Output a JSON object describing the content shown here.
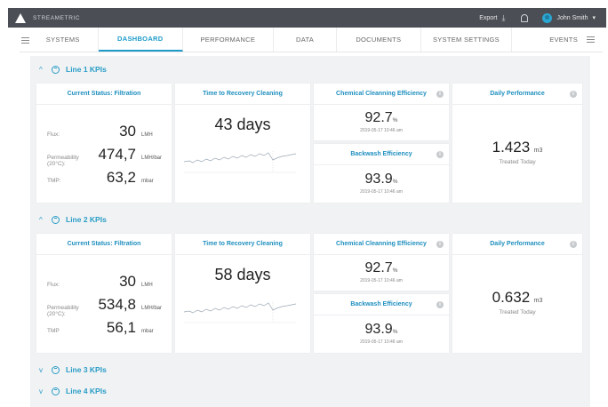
{
  "topbar": {
    "brand": "STREAMETRIC",
    "export_label": "Export",
    "user_name": "John Smith",
    "caret": "▾"
  },
  "nav": {
    "items": [
      {
        "label": "SYSTEMS"
      },
      {
        "label": "DASHBOARD"
      },
      {
        "label": "PERFORMANCE"
      },
      {
        "label": "DATA"
      },
      {
        "label": "DOCUMENTS"
      },
      {
        "label": "SYSTEM SETTINGS"
      },
      {
        "label": "EVENTS"
      }
    ],
    "active_index": 1
  },
  "lines": [
    {
      "title": "Line 1 KPIs",
      "expanded": true,
      "status_title": "Current Status: Filtration",
      "flux_label": "Flux:",
      "flux_value": "30",
      "flux_unit": "LMH",
      "perm_label": "Permeability (20°C):",
      "perm_value": "474,7",
      "perm_unit": "LMH/bar",
      "tmp_label": "TMP:",
      "tmp_value": "63,2",
      "tmp_unit": "mbar",
      "recovery_title": "Time to Recovery Cleaning",
      "recovery_value": "43 days",
      "chem_title": "Chemical Cleanning Efficiency",
      "chem_value": "92.7",
      "chem_unit": "%",
      "chem_ts": "2019-05-17 10:46 am",
      "back_title": "Backwash Efficiency",
      "back_value": "93.9",
      "back_unit": "%",
      "back_ts": "2019-05-17 10:46 am",
      "daily_title": "Daily Performance",
      "daily_value": "1.423",
      "daily_unit": "m3",
      "daily_sub": "Treated Today"
    },
    {
      "title": "Line 2 KPIs",
      "expanded": true,
      "status_title": "Current Status: Filtration",
      "flux_label": "Flux:",
      "flux_value": "30",
      "flux_unit": "LMH",
      "perm_label": "Permeability (20°C):",
      "perm_value": "534,8",
      "perm_unit": "LMH/bar",
      "tmp_label": "TMP",
      "tmp_value": "56,1",
      "tmp_unit": "mbar",
      "recovery_title": "Time to Recovery Cleaning",
      "recovery_value": "58 days",
      "chem_title": "Chemical Cleanning Efficiency",
      "chem_value": "92.7",
      "chem_unit": "%",
      "chem_ts": "2019-05-17 10:46 am",
      "back_title": "Backwash Efficiency",
      "back_value": "93.9",
      "back_unit": "%",
      "back_ts": "2019-05-17 10:46 am",
      "daily_title": "Daily Performance",
      "daily_value": "0.632",
      "daily_unit": "m3",
      "daily_sub": "Treated Today"
    },
    {
      "title": "Line 3 KPIs",
      "expanded": false
    },
    {
      "title": "Line 4 KPIs",
      "expanded": false
    }
  ],
  "icons": {
    "expanded": "^",
    "collapsed": "v",
    "info": "i",
    "download": "⤓"
  },
  "colors": {
    "accent": "#1e9bc9",
    "topbar": "#4b4e55",
    "background": "#f0f2f4"
  }
}
